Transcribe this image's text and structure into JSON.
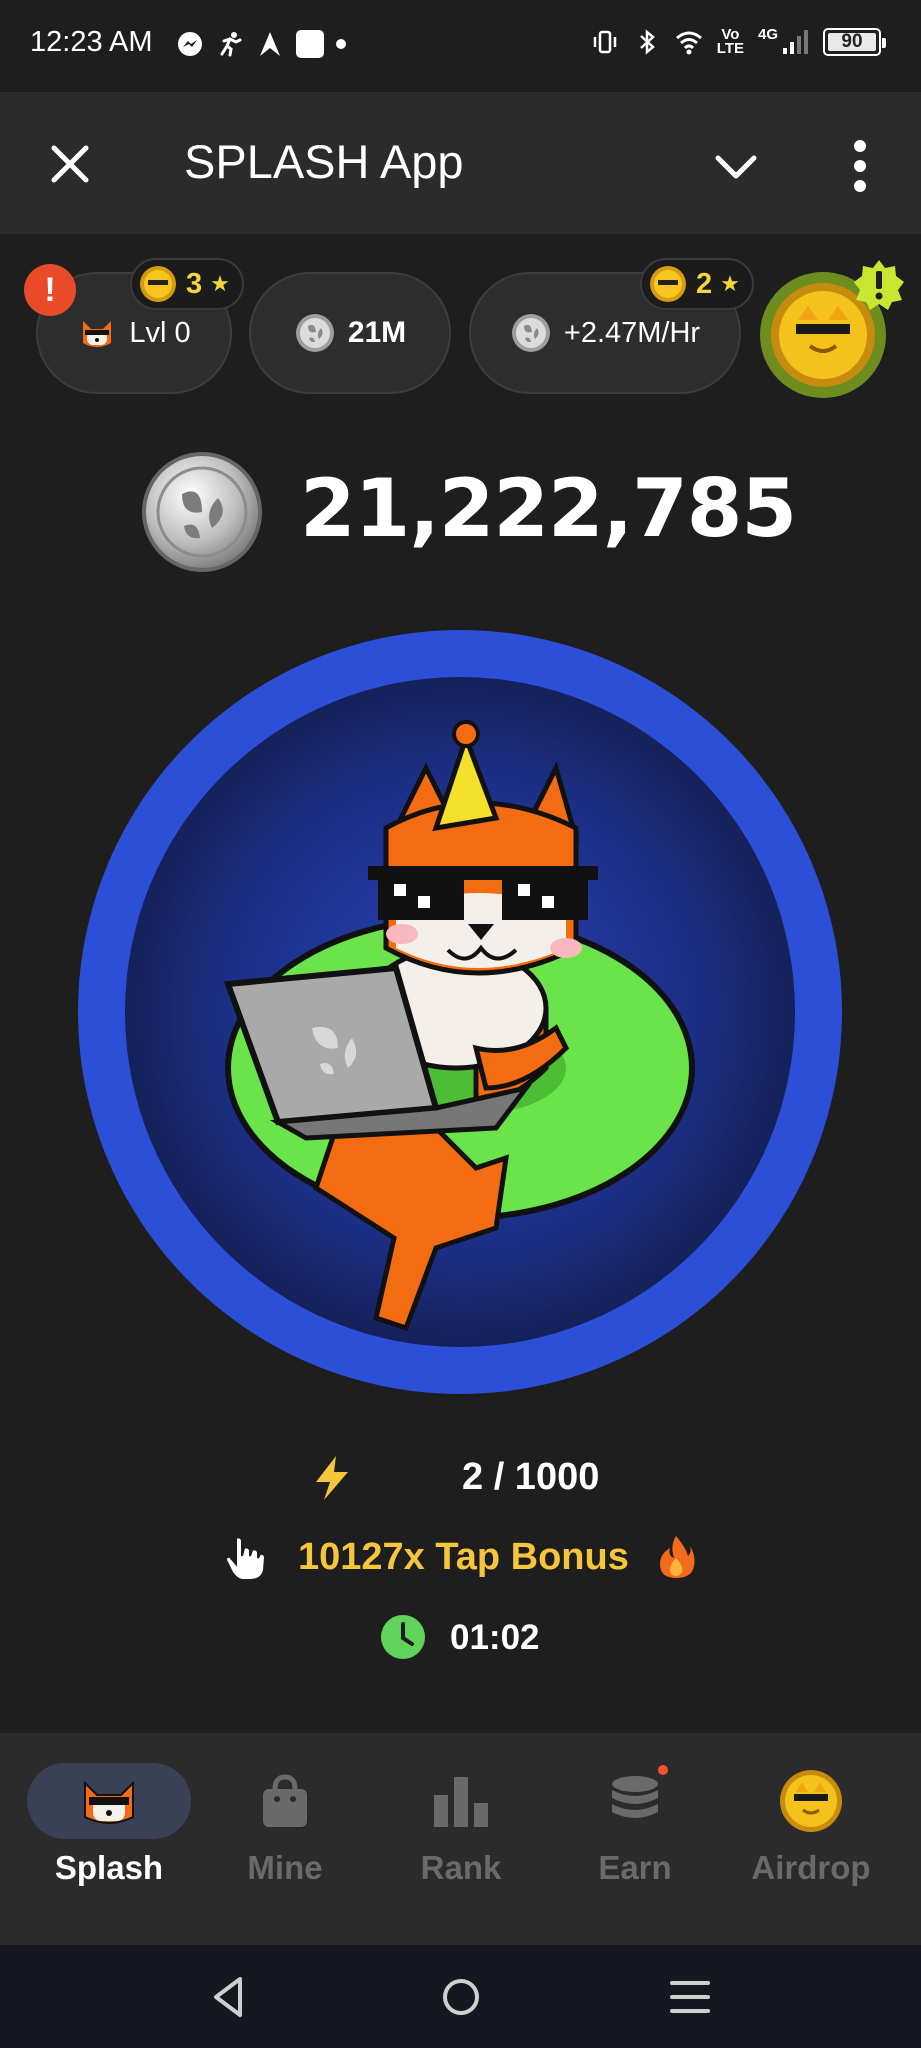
{
  "status_bar": {
    "time": "12:23 AM",
    "network_vo": "Vo",
    "network_lte": "LTE",
    "network_4g": "4G",
    "battery": "90",
    "icons": [
      "messenger-icon",
      "running-icon",
      "arrow-icon",
      "white-square-icon",
      "dot-icon",
      "vibrate-icon",
      "bluetooth-icon",
      "wifi-icon",
      "signal-icon"
    ]
  },
  "app_bar": {
    "title": "SPLASH App"
  },
  "top_chips": {
    "level_badge_count": "3",
    "level_label": "Lvl 0",
    "coins_label": "21M",
    "rate_badge_count": "2",
    "rate_label": "+2.47M/Hr",
    "alert_mark": "!"
  },
  "balance": {
    "value": "21,222,785"
  },
  "energy": {
    "value": "2 / 1000"
  },
  "tap_bonus": {
    "label": "10127x Tap Bonus"
  },
  "timer": {
    "value": "01:02"
  },
  "bottom_nav": {
    "items": [
      {
        "label": "Splash",
        "icon": "shiba-icon",
        "active": true
      },
      {
        "label": "Mine",
        "icon": "bag-icon",
        "active": false
      },
      {
        "label": "Rank",
        "icon": "bar-chart-icon",
        "active": false
      },
      {
        "label": "Earn",
        "icon": "coin-stack-icon",
        "active": false
      },
      {
        "label": "Airdrop",
        "icon": "gold-coin-icon",
        "active": false
      }
    ]
  },
  "colors": {
    "background": "#1e1e1e",
    "bar": "#2b2b2b",
    "accent_gold": "#f5c53b",
    "energy_green": "#5fd35a",
    "tap_blue": "#2b4fd6",
    "active_nav": "#3a4157"
  }
}
